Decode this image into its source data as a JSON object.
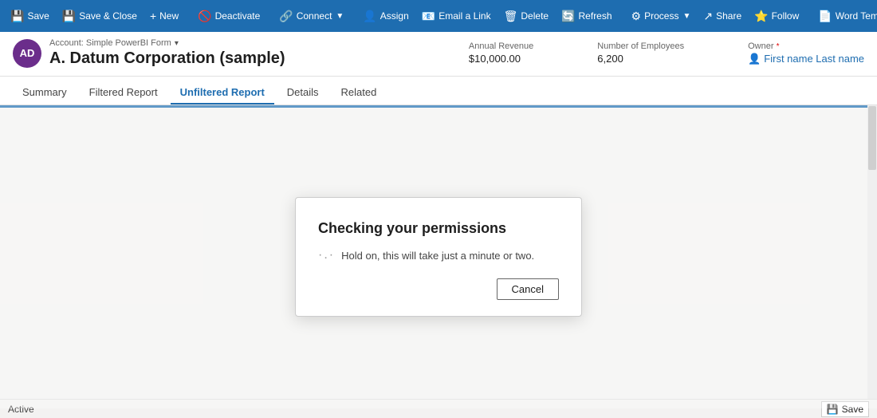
{
  "toolbar": {
    "buttons": [
      {
        "id": "save",
        "icon": "💾",
        "label": "Save",
        "has_dropdown": false
      },
      {
        "id": "save-close",
        "icon": "💾",
        "label": "Save & Close",
        "has_dropdown": false
      },
      {
        "id": "new",
        "icon": "+",
        "label": "New",
        "has_dropdown": false
      },
      {
        "id": "deactivate",
        "icon": "🚫",
        "label": "Deactivate",
        "has_dropdown": false
      },
      {
        "id": "connect",
        "icon": "🔗",
        "label": "Connect",
        "has_dropdown": true
      },
      {
        "id": "assign",
        "icon": "👤",
        "label": "Assign",
        "has_dropdown": false
      },
      {
        "id": "email-link",
        "icon": "📧",
        "label": "Email a Link",
        "has_dropdown": false
      },
      {
        "id": "delete",
        "icon": "🗑",
        "label": "Delete",
        "has_dropdown": false
      },
      {
        "id": "refresh",
        "icon": "🔄",
        "label": "Refresh",
        "has_dropdown": false
      },
      {
        "id": "process",
        "icon": "⚙",
        "label": "Process",
        "has_dropdown": true
      },
      {
        "id": "share",
        "icon": "↗",
        "label": "Share",
        "has_dropdown": false
      },
      {
        "id": "follow",
        "icon": "⭐",
        "label": "Follow",
        "has_dropdown": false
      },
      {
        "id": "word-templates",
        "icon": "📄",
        "label": "Word Templates",
        "has_dropdown": true
      }
    ]
  },
  "record": {
    "avatar_initials": "AD",
    "form_label": "Account: Simple PowerBI Form",
    "title": "A. Datum Corporation (sample)",
    "fields": [
      {
        "id": "annual-revenue",
        "label": "Annual Revenue",
        "value": "$10,000.00"
      },
      {
        "id": "employees",
        "label": "Number of Employees",
        "value": "6,200"
      },
      {
        "id": "owner",
        "label": "Owner",
        "value": "First name Last name",
        "is_link": true,
        "required": true
      }
    ]
  },
  "tabs": [
    {
      "id": "summary",
      "label": "Summary",
      "active": false
    },
    {
      "id": "filtered-report",
      "label": "Filtered Report",
      "active": false
    },
    {
      "id": "unfiltered-report",
      "label": "Unfiltered Report",
      "active": true
    },
    {
      "id": "details",
      "label": "Details",
      "active": false
    },
    {
      "id": "related",
      "label": "Related",
      "active": false
    }
  ],
  "modal": {
    "title": "Checking your permissions",
    "body": "Hold on, this will take just a minute or two.",
    "cancel_label": "Cancel",
    "spinner": "·.·"
  },
  "status_bar": {
    "status": "Active",
    "save_label": "Save"
  }
}
